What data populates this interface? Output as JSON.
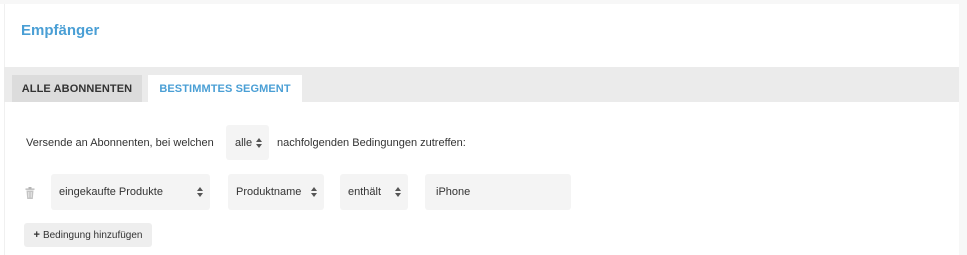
{
  "section": {
    "title": "Empfänger"
  },
  "tabs": [
    {
      "label": "ALLE ABONNENTEN",
      "active": false
    },
    {
      "label": "BESTIMMTES SEGMENT",
      "active": true
    }
  ],
  "rule": {
    "prefix": "Versende an Abonnenten, bei welchen",
    "match_mode": "alle",
    "suffix": "nachfolgenden Bedingungen zutreffen:"
  },
  "condition": {
    "field": "eingekaufte Produkte",
    "property": "Produktname",
    "operator": "enthält",
    "value": "iPhone"
  },
  "add_condition": {
    "icon": "plus-icon",
    "label": "Bedingung hinzufügen"
  },
  "colors": {
    "accent": "#4a9fd5",
    "tabbar": "#ebebeb",
    "input_bg": "#f4f4f4"
  }
}
